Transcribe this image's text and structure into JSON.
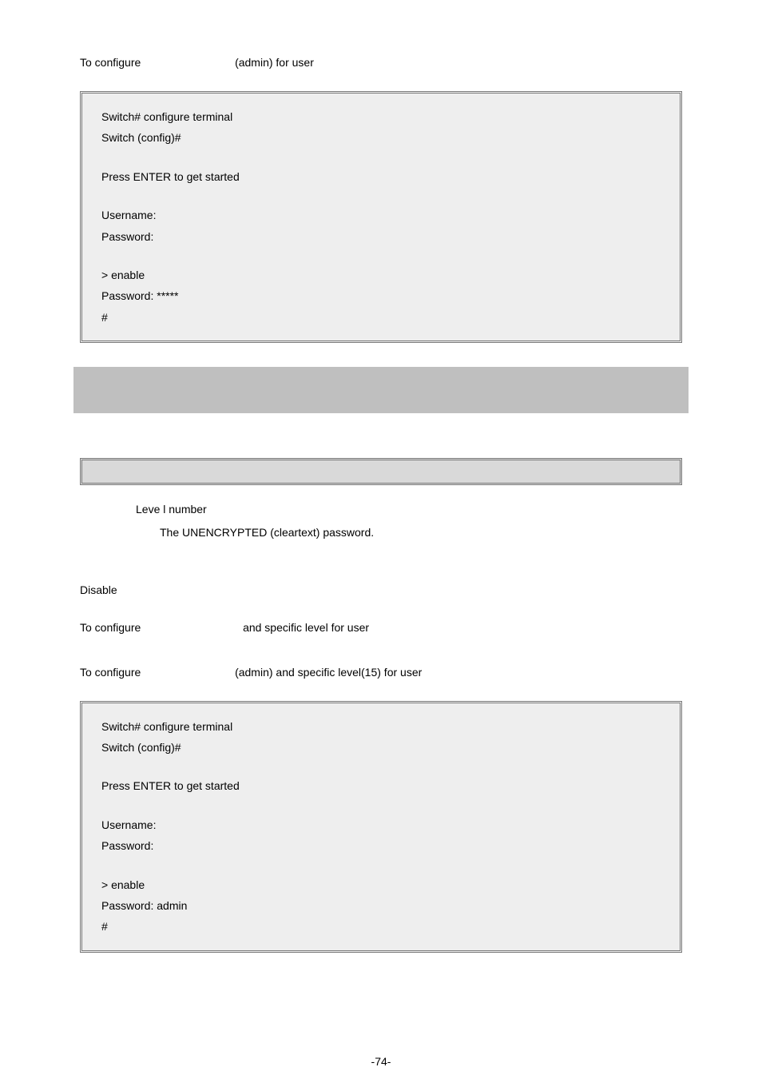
{
  "intro1": {
    "part1": "To configure",
    "part2": "(admin) for user"
  },
  "code1": {
    "l1": "Switch# configure terminal",
    "l2": "Switch (config)#",
    "l3": "Press ENTER to get started",
    "l4": "Username:",
    "l5": "Password:",
    "l6": "> enable",
    "l7": "Password: *****",
    "l8": "#"
  },
  "desc": {
    "d1": "Leve   l number",
    "d2": "The UNENCRYPTED (cleartext) password."
  },
  "disable": "Disable",
  "intro2": {
    "part1": "To configure",
    "part2": "and specific level for user"
  },
  "intro3": {
    "part1": "To configure",
    "part2": "(admin) and specific level(15) for user"
  },
  "code2": {
    "l1": "Switch# configure terminal",
    "l2": "Switch (config)#",
    "l3": "Press ENTER to get started",
    "l4": "Username:",
    "l5": "Password:",
    "l6": "> enable",
    "l7": "Password: admin",
    "l8": "#"
  },
  "pagenum": "-74-"
}
